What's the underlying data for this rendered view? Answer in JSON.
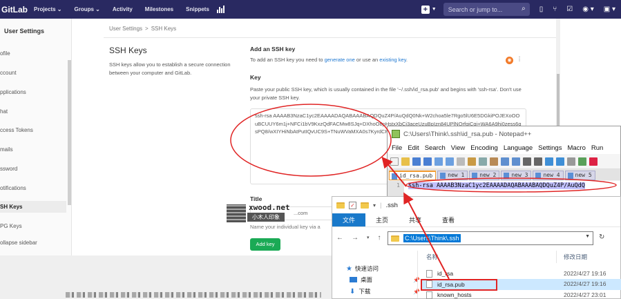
{
  "topbar": {
    "brand": "GitLab",
    "nav": [
      "Projects ⌄",
      "Groups ⌄",
      "Activity",
      "Milestones",
      "Snippets"
    ],
    "search_placeholder": "Search or jump to..."
  },
  "sidebar": {
    "header": "User Settings",
    "items": [
      {
        "label": "ofile"
      },
      {
        "label": "ccount"
      },
      {
        "label": "pplications"
      },
      {
        "label": "hat"
      },
      {
        "label": "ccess Tokens"
      },
      {
        "label": "mails"
      },
      {
        "label": "ssword"
      },
      {
        "label": "otifications"
      },
      {
        "label": "SH Keys",
        "active": true
      },
      {
        "label": "PG Keys"
      },
      {
        "label": "ollapse sidebar"
      }
    ]
  },
  "breadcrumb": {
    "parent": "User Settings",
    "sep": ">",
    "current": "SSH Keys"
  },
  "page": {
    "title": "SSH Keys",
    "description": "SSH keys allow you to establish a secure connection between your computer and GitLab."
  },
  "add_key": {
    "heading": "Add an SSH key",
    "intro_before": "To add an SSH key you need to",
    "generate_link": "generate one",
    "intro_mid": "or use an",
    "existing_link": "existing key",
    "intro_after": ".",
    "key_label": "Key",
    "key_hint": "Paste your public SSH key, which is usually contained in the file '~/.ssh/id_rsa.pub' and begins with 'ssh-rsa'. Don't use your private SSH key.",
    "key_value": "ssh-rsa AAAAB3NzaC1yc2EAAAADAQABAAABAQDQuZ4P/AuQdQ0Nk+W2choa5le7Rgo5lU6E5DGkiPOJEXoOOuBCUUY6m1j+NFCi1bV9KxzQdFACMw8SJq+DXhoO8pHstxXbCi3aceUzuBpIzn84UPlNQrfgjCqi+WA6A9hj0zess6qsPQ8/wXIYHiNbAtPutIQvUC9S+TNuWVaMXA0s7KyrdCRIHZOOS3F+ubIpz",
    "title_label": "Title",
    "title_value": "...com",
    "title_hint": "Name your individual key via a",
    "add_button": "Add key"
  },
  "watermark": {
    "line1": "xwood.net",
    "line2": "小木人印象"
  },
  "notepad": {
    "title": "C:\\Users\\Think\\.ssh\\id_rsa.pub - Notepad++",
    "menu": [
      "File",
      "Edit",
      "Search",
      "View",
      "Encoding",
      "Language",
      "Settings",
      "Macro",
      "Run"
    ],
    "tabs": [
      "id_rsa.pub",
      "new 1",
      "new 2",
      "new 3",
      "new 4",
      "new 5"
    ],
    "line_number": "1",
    "line1": "ssh-rsa AAAAB3NzaC1yc2EAAAADAQABAAABAQDQuZ4P/AuQdQ"
  },
  "explorer": {
    "title": ".ssh",
    "ribbon": [
      "文件",
      "主页",
      "共享",
      "查看"
    ],
    "address": "C:\\Users\\Think\\.ssh",
    "nav": [
      "快速访问",
      "桌面",
      "下载"
    ],
    "col_name": "名称",
    "col_date": "修改日期",
    "files": [
      {
        "name": "id_rsa",
        "date": "2022/4/27 19:16"
      },
      {
        "name": "id_rsa.pub",
        "date": "2022/4/27 19:16",
        "selected": true
      },
      {
        "name": "known_hosts",
        "date": "2022/4/27 23:01"
      }
    ]
  },
  "colors": {
    "gitlab_nav": "#292961",
    "annotation": "#e02424",
    "add_button": "#1aaa55",
    "explorer_file_tab": "#1979ca"
  }
}
